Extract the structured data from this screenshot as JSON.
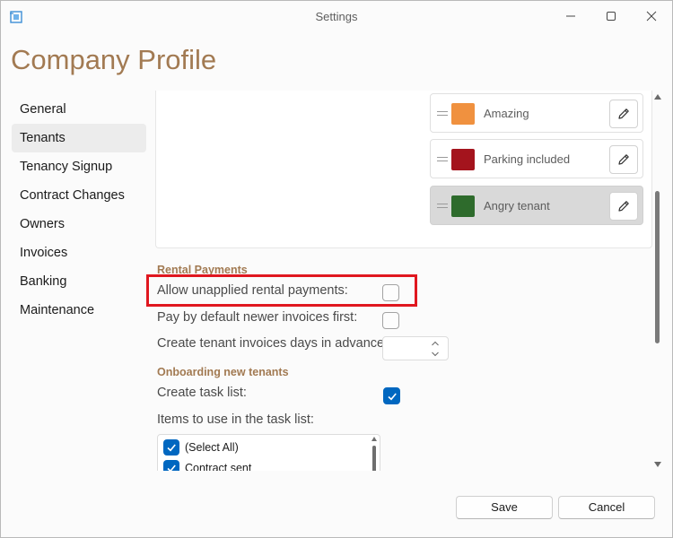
{
  "window": {
    "title": "Settings",
    "app_icon": "app-window-icon",
    "controls": [
      "minimize-icon",
      "maximize-icon",
      "close-icon"
    ]
  },
  "page": {
    "title": "Company Profile"
  },
  "nav": {
    "selected": "Tenants",
    "items": [
      {
        "label": "General"
      },
      {
        "label": "Tenants"
      },
      {
        "label": "Tenancy Signup"
      },
      {
        "label": "Contract Changes"
      },
      {
        "label": "Owners"
      },
      {
        "label": "Invoices"
      },
      {
        "label": "Banking"
      },
      {
        "label": "Maintenance"
      }
    ]
  },
  "tags": [
    {
      "label": "Amazing",
      "color": "#f0913f",
      "active": false
    },
    {
      "label": "Parking included",
      "color": "#a4141d",
      "active": false
    },
    {
      "label": "Angry tenant",
      "color": "#2e6b2c",
      "active": true
    }
  ],
  "rental_payments": {
    "heading": "Rental Payments",
    "allow_unapplied_label": "Allow unapplied rental payments:",
    "allow_unapplied_checked": false,
    "pay_newer_first_label": "Pay by default newer invoices first:",
    "pay_newer_first_checked": false,
    "invoice_days_label": "Create tenant invoices days in advance:",
    "invoice_days_value": ""
  },
  "onboarding": {
    "heading": "Onboarding new tenants",
    "create_task_list_label": "Create task list:",
    "create_task_list_checked": true,
    "items_label": "Items to use in the task list:",
    "task_items": [
      {
        "label": "(Select All)",
        "checked": true
      },
      {
        "label": "Contract sent",
        "checked": true
      }
    ]
  },
  "footer": {
    "save_label": "Save",
    "cancel_label": "Cancel"
  },
  "colors": {
    "accent": "#a27a52",
    "checkbox_blue": "#0067c0",
    "highlight": "#e0171f"
  }
}
